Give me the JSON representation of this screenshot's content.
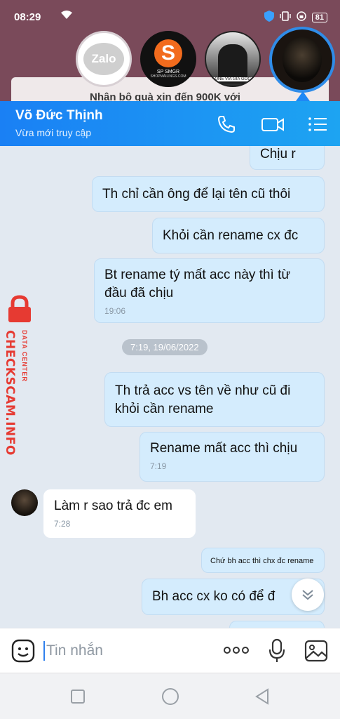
{
  "status_bar": {
    "time": "08:29",
    "battery": "81"
  },
  "chat_heads": {
    "zalo_label": "Zalo",
    "sp_label": "SP SMGR",
    "sp_sub": "SHOPMAILINGS.COM",
    "suit_caption": "ONE VIA GIÁ GỐC",
    "behind_banner": "Nhận bộ quà xin đến 900K với"
  },
  "header": {
    "contact_name": "Võ Đức Thịnh",
    "status": "Vừa mới truy cập"
  },
  "messages": [
    {
      "text": "Chịu r",
      "time": ""
    },
    {
      "text": "Th chỉ cần ông để lại tên cũ thôi",
      "time": ""
    },
    {
      "text": "Khỏi cần rename cx đc",
      "time": ""
    },
    {
      "text": "Bt rename tý mất acc này thì từ đầu đã chịu",
      "time": "19:06"
    },
    {
      "text": "Th trả acc vs tên về như cũ đi khỏi cần rename",
      "time": ""
    },
    {
      "text": "Rename mất acc thì chịu",
      "time": "7:19"
    },
    {
      "text": "Làm r sao trả đc em",
      "time": "7:28"
    },
    {
      "text": "Chứ bh acc thì chx đc rename",
      "time": ""
    },
    {
      "text": "Bh acc cx ko có để đ",
      "time": ""
    }
  ],
  "date_separator": "7:19, 19/06/2022",
  "watermark": {
    "big": "CHECKSCAM.INFO",
    "small": "DATA CENTER"
  },
  "input": {
    "placeholder": "Tin nhắn"
  },
  "colors": {
    "header_blue": "#1a80f4",
    "outgoing_bubble": "#d4ecfd",
    "incoming_bubble": "#ffffff",
    "watermark_red": "#e63a32"
  }
}
